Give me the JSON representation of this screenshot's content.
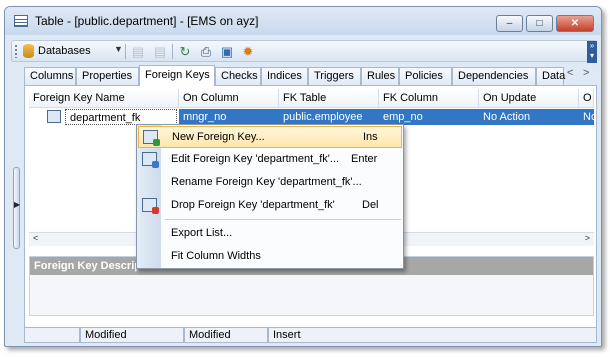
{
  "window": {
    "title": "Table - [public.department] - [EMS on ayz]"
  },
  "window_buttons": [
    "–",
    "□",
    "✕"
  ],
  "toolbar": {
    "databases_label": "Databases",
    "icons": [
      "add-icon",
      "remove-icon",
      "refresh-icon",
      "print-icon",
      "export-icon",
      "settings-icon"
    ]
  },
  "tabs": [
    "Columns",
    "Properties",
    "Foreign Keys",
    "Checks",
    "Indices",
    "Triggers",
    "Rules",
    "Policies",
    "Dependencies",
    "Data"
  ],
  "active_tab": "Foreign Keys",
  "grid": {
    "columns": [
      "Foreign Key Name",
      "On Column",
      "FK Table",
      "FK Column",
      "On Update",
      "O"
    ],
    "rows": [
      [
        "department_fk",
        "mngr_no",
        "public.employee",
        "emp_no",
        "No Action",
        "No"
      ]
    ]
  },
  "context_menu": {
    "items": [
      {
        "label": "New Foreign Key...",
        "shortcut": "Ins",
        "icon": "new-foreign-key-icon"
      },
      {
        "label": "Edit Foreign Key 'department_fk'...",
        "shortcut": "Enter",
        "icon": "edit-foreign-key-icon"
      },
      {
        "label": "Rename Foreign Key 'department_fk'...",
        "shortcut": "",
        "icon": ""
      },
      {
        "label": "Drop Foreign Key 'department_fk'",
        "shortcut": "Del",
        "icon": "drop-foreign-key-icon"
      },
      {
        "label": "Export List...",
        "shortcut": "",
        "icon": ""
      },
      {
        "label": "Fit Column Widths",
        "shortcut": "",
        "icon": ""
      }
    ]
  },
  "description_panel": {
    "title": "Foreign Key Descrip"
  },
  "statusbar": [
    "",
    "Modified",
    "Modified",
    "Insert"
  ],
  "colors": {
    "selection": "#3276c4",
    "highlight": "#fde6a8",
    "window_bg": "#dfe9f5"
  }
}
